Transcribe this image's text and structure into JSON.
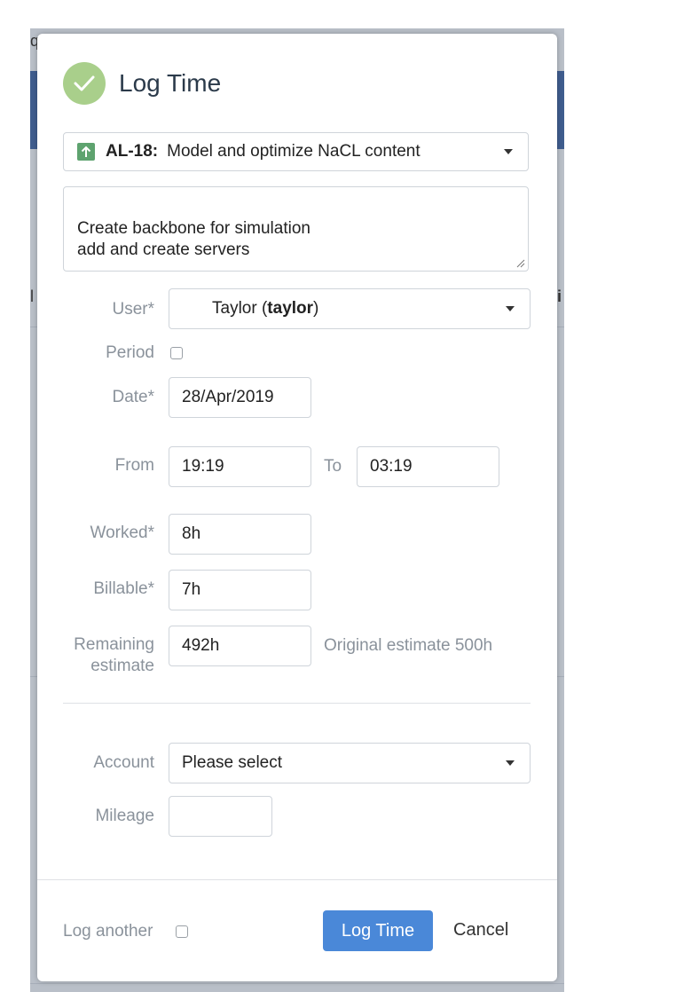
{
  "backdrop": {
    "frag_top": "q",
    "frag_mid_left": "l",
    "frag_mid_right": "i"
  },
  "dialog": {
    "title": "Log Time",
    "issue": {
      "key": "AL-18:",
      "summary": "Model and optimize NaCL content"
    },
    "description": "Create backbone for simulation\nadd and create servers",
    "user": {
      "label": "User*",
      "name_prefix": "Taylor (",
      "username": "taylor",
      "name_suffix": ")"
    },
    "period": {
      "label": "Period",
      "checked": false
    },
    "date": {
      "label": "Date*",
      "value": "28/Apr/2019"
    },
    "from": {
      "label": "From",
      "value": "19:19"
    },
    "to": {
      "label": "To",
      "value": "03:19"
    },
    "worked": {
      "label": "Worked*",
      "value": "8h"
    },
    "billable": {
      "label": "Billable*",
      "value": "7h"
    },
    "remaining": {
      "label_line1": "Remaining",
      "label_line2": "estimate",
      "value": "492h",
      "hint": "Original estimate 500h"
    },
    "account": {
      "label": "Account",
      "value": "Please select"
    },
    "mileage": {
      "label": "Mileage",
      "value": ""
    }
  },
  "footer": {
    "log_another_label": "Log another",
    "log_another_checked": false,
    "submit_label": "Log Time",
    "cancel_label": "Cancel"
  },
  "colors": {
    "primary": "#4a88d8",
    "success": "#a9cf8b",
    "issue_icon": "#5ea36f"
  }
}
